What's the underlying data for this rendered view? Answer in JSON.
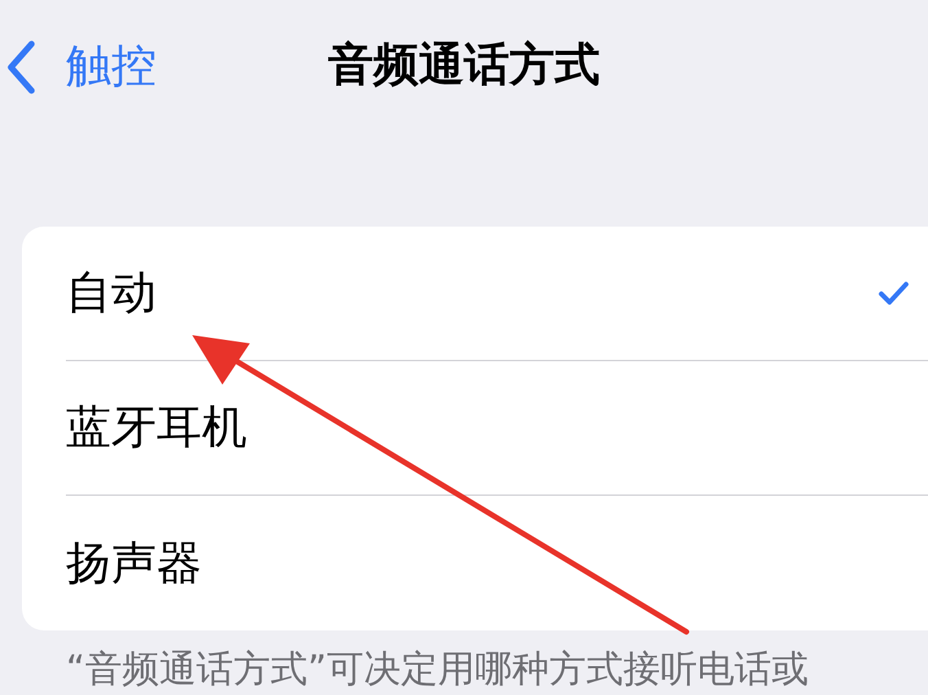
{
  "nav": {
    "back_label": "触控",
    "title": "音频通话方式"
  },
  "options": [
    {
      "label": "自动",
      "selected": true
    },
    {
      "label": "蓝牙耳机",
      "selected": false
    },
    {
      "label": "扬声器",
      "selected": false
    }
  ],
  "footer_text": "“音频通话方式”可决定用哪种方式接听电话或"
}
